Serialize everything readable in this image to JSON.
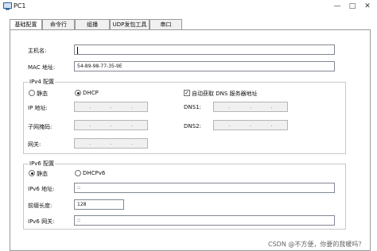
{
  "window": {
    "title": "PC1",
    "minimize": "—",
    "maximize": "□",
    "close": "✕"
  },
  "tabs": [
    {
      "label": "基础配置",
      "active": true
    },
    {
      "label": "命令行"
    },
    {
      "label": "组播"
    },
    {
      "label": "UDP发包工具"
    },
    {
      "label": "串口"
    }
  ],
  "basic": {
    "hostname_label": "主机名:",
    "hostname_value": "",
    "mac_label": "MAC 地址:",
    "mac_value": "54-89-98-77-35-9E"
  },
  "ipv4": {
    "group_title": "IPv4 配置",
    "static_label": "静态",
    "dhcp_label": "DHCP",
    "mode": "DHCP",
    "auto_dns_label": "自动获取 DNS 服务器地址",
    "auto_dns_checked": true,
    "ip_label": "IP 地址:",
    "mask_label": "子网掩码:",
    "gateway_label": "网关:",
    "dns1_label": "DNS1:",
    "dns2_label": "DNS2:",
    "ip_dots": [
      ".",
      ".",
      "."
    ]
  },
  "ipv6": {
    "group_title": "IPv6 配置",
    "static_label": "静态",
    "dhcp_label": "DHCPv6",
    "mode": "静态",
    "ip_label": "IPv6 地址:",
    "ip_value": "::",
    "prefix_label": "前缀长度:",
    "prefix_value": "128",
    "gateway_label": "IPv6 网关:",
    "gateway_value": "::"
  },
  "watermark": "CSDN @不方便，你要的我暖吗？",
  "icons": [
    "pc-icon",
    "radio-icon",
    "checkbox-icon"
  ]
}
